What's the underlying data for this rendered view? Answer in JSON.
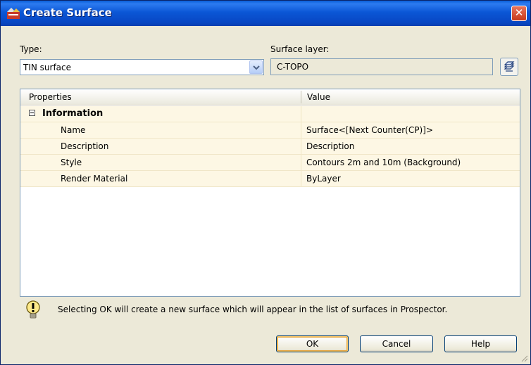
{
  "window": {
    "title": "Create Surface",
    "close_glyph": "✕"
  },
  "type_field": {
    "label": "Type:",
    "value": "TIN surface"
  },
  "layer_field": {
    "label": "Surface layer:",
    "value": "C-TOPO"
  },
  "grid": {
    "headers": {
      "properties": "Properties",
      "value": "Value"
    },
    "category": {
      "label": "Information",
      "expanded": true
    },
    "rows": [
      {
        "name": "Name",
        "value": "Surface<[Next Counter(CP)]>"
      },
      {
        "name": "Description",
        "value": "Description"
      },
      {
        "name": "Style",
        "value": "Contours 2m and 10m (Background)"
      },
      {
        "name": "Render Material",
        "value": "ByLayer"
      }
    ]
  },
  "info": {
    "icon": "lightbulb-icon",
    "text": "Selecting OK will create a new surface which will appear in the list of surfaces in Prospector."
  },
  "buttons": {
    "ok": "OK",
    "cancel": "Cancel",
    "help": "Help"
  },
  "colors": {
    "title_bar": "#0a5fd8",
    "row_bg": "#fdf7e4",
    "window_bg": "#ece9d8"
  }
}
